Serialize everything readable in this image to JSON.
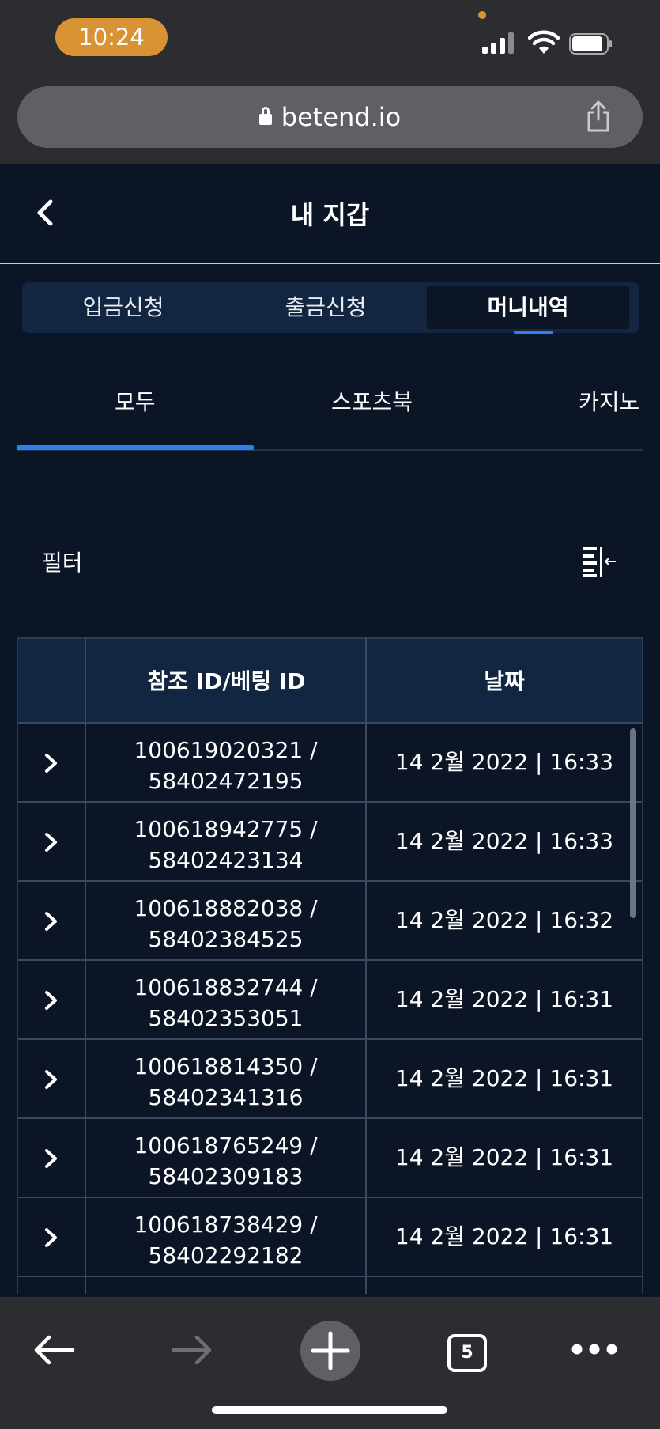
{
  "status_bar": {
    "time": "10:24"
  },
  "browser": {
    "url": "betend.io",
    "open_tabs_count": "5"
  },
  "header": {
    "title": "내 지갑"
  },
  "segment_tabs": [
    {
      "label": "입금신청",
      "active": false
    },
    {
      "label": "출금신청",
      "active": false
    },
    {
      "label": "머니내역",
      "active": true
    }
  ],
  "category_tabs": [
    {
      "label": "모두",
      "active": true
    },
    {
      "label": "스포츠북",
      "active": false
    },
    {
      "label": "카지노",
      "active": false
    }
  ],
  "filter": {
    "label": "필터"
  },
  "table": {
    "columns": [
      "",
      "참조 ID/베팅 ID",
      "날짜"
    ],
    "rows": [
      {
        "ref_id": "100619020321 /",
        "bet_id": "58402472195",
        "date": "14 2월 2022 | 16:33"
      },
      {
        "ref_id": "100618942775 /",
        "bet_id": "58402423134",
        "date": "14 2월 2022 | 16:33"
      },
      {
        "ref_id": "100618882038 /",
        "bet_id": "58402384525",
        "date": "14 2월 2022 | 16:32"
      },
      {
        "ref_id": "100618832744 /",
        "bet_id": "58402353051",
        "date": "14 2월 2022 | 16:31"
      },
      {
        "ref_id": "100618814350 /",
        "bet_id": "58402341316",
        "date": "14 2월 2022 | 16:31"
      },
      {
        "ref_id": "100618765249 /",
        "bet_id": "58402309183",
        "date": "14 2월 2022 | 16:31"
      },
      {
        "ref_id": "100618738429 /",
        "bet_id": "58402292182",
        "date": "14 2월 2022 | 16:31"
      },
      {
        "ref_id": "",
        "bet_id": "",
        "date": ""
      }
    ]
  },
  "colors": {
    "accent": "#2f80ed",
    "background": "#0c1526",
    "header_bg": "#132641",
    "time_pill": "#d99234"
  },
  "icons": [
    "lock-icon",
    "share-icon",
    "back-icon",
    "filter-icon",
    "chevron-right-icon",
    "arrow-left-icon",
    "arrow-right-icon",
    "plus-icon",
    "tabs-icon",
    "more-icon"
  ]
}
